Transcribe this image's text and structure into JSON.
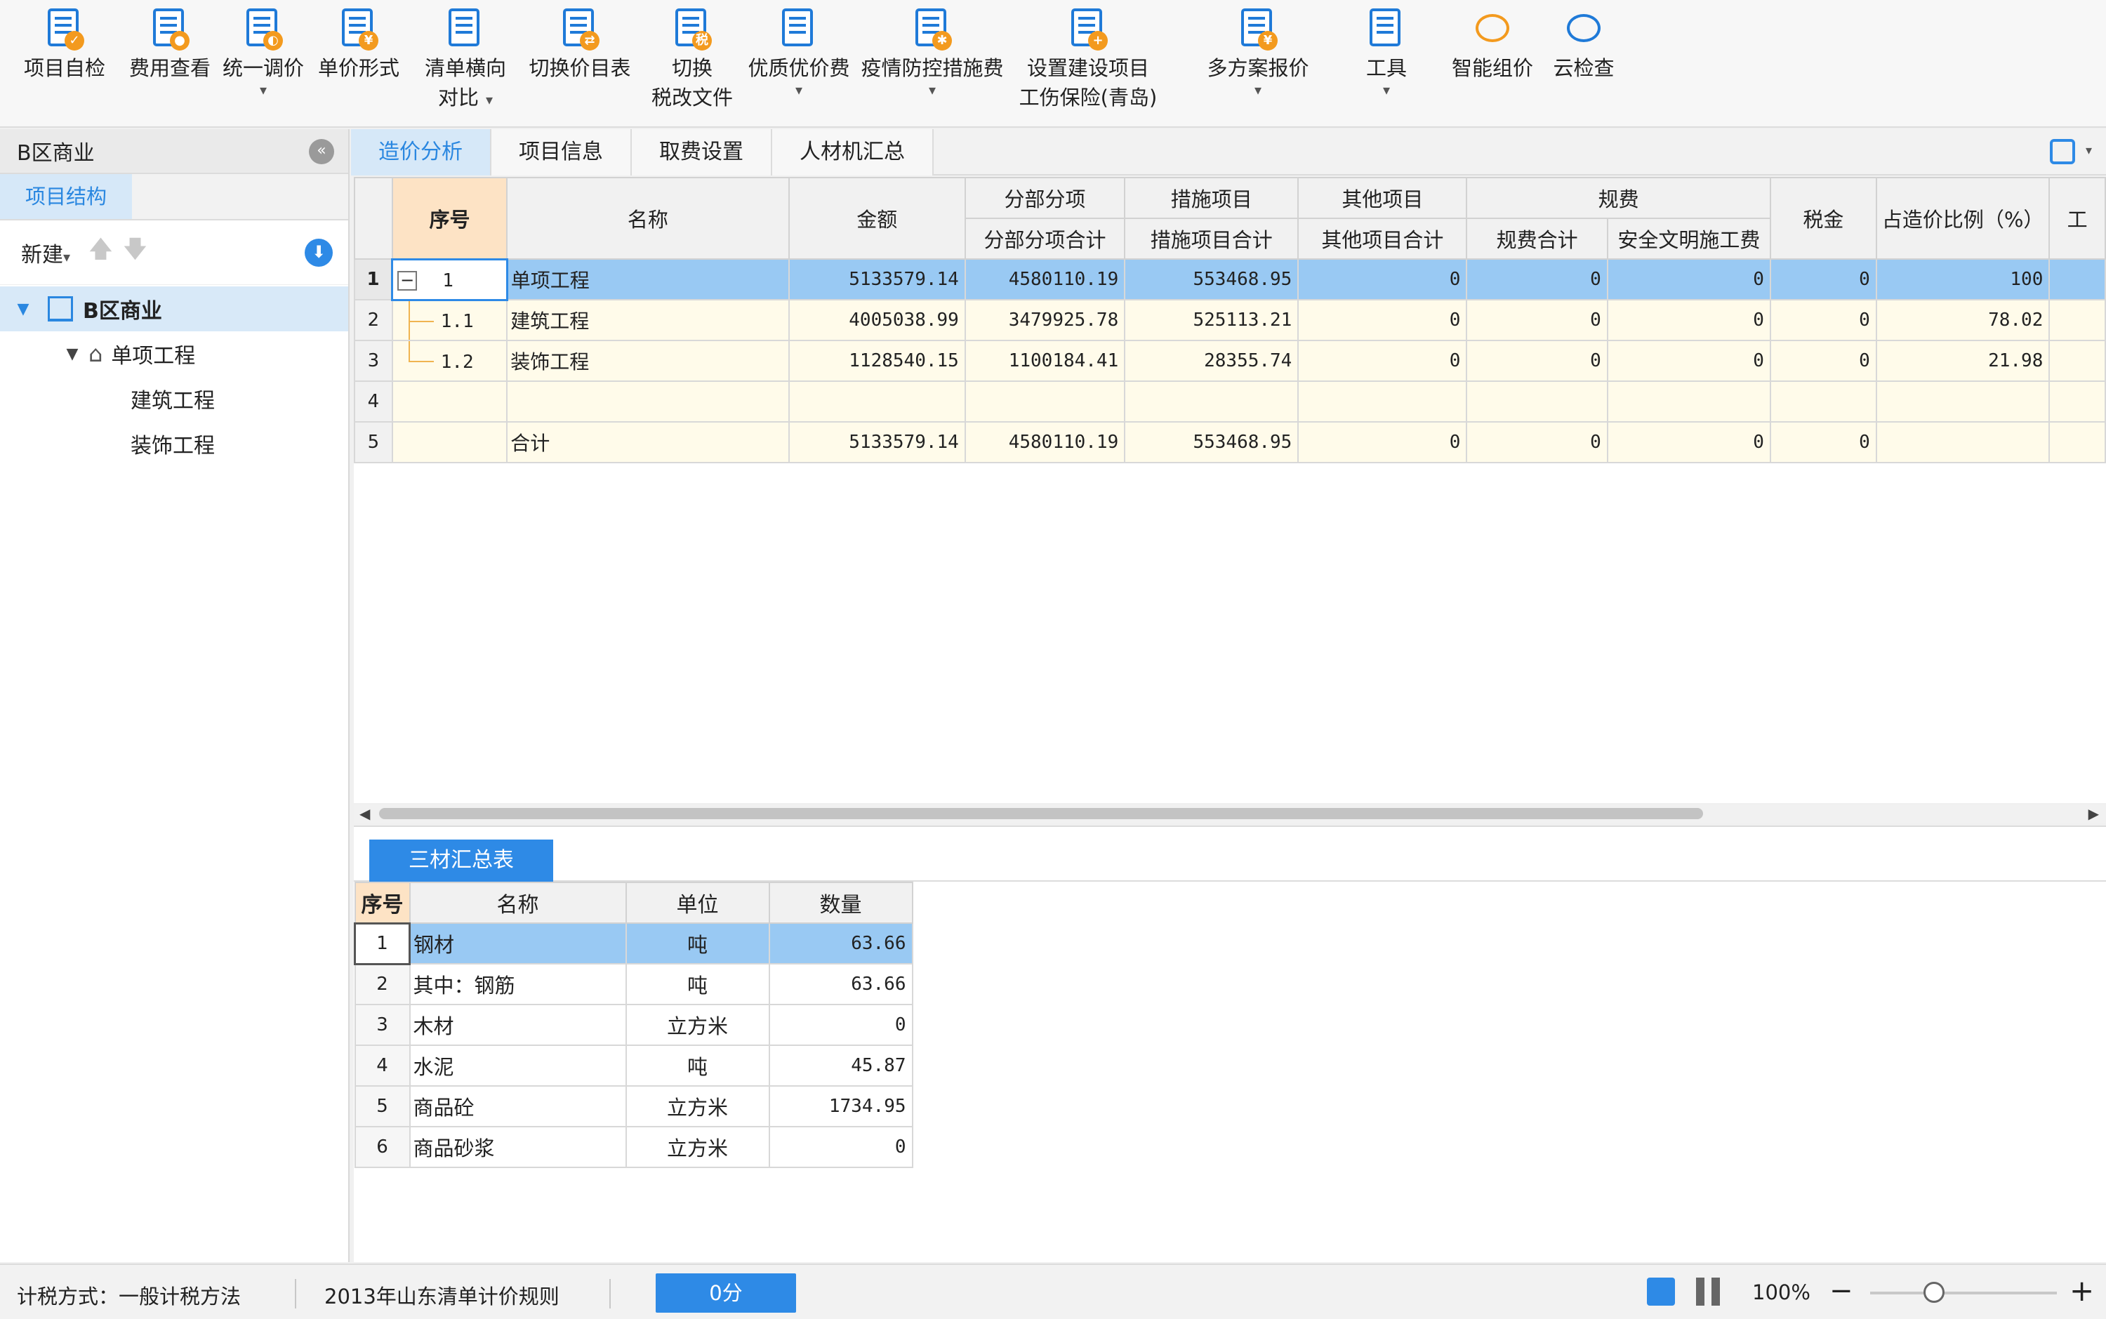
{
  "toolbar": {
    "items": [
      {
        "label": "项目自检",
        "icon": "check-doc-icon"
      },
      {
        "label": "费用查看",
        "icon": "view-cost-icon"
      },
      {
        "label": "统一调价",
        "icon": "adjust-price-icon",
        "dropdown": "▾"
      },
      {
        "label": "单价形式",
        "icon": "unit-price-icon"
      },
      {
        "label": "清单横向",
        "label2": "对比",
        "icon": "compare-icon",
        "dropdown": "▾"
      },
      {
        "label": "切换价目表",
        "icon": "switch-price-table-icon"
      },
      {
        "label": "切换",
        "label2": "税改文件",
        "icon": "tax-file-icon"
      },
      {
        "label": "优质优价费",
        "icon": "quality-price-icon",
        "dropdown": "▾"
      },
      {
        "label": "疫情防控措施费",
        "icon": "epidemic-icon",
        "dropdown": "▾"
      },
      {
        "label": "设置建设项目",
        "label2": "工伤保险(青岛)",
        "icon": "insurance-icon"
      },
      {
        "label": "多方案报价",
        "icon": "multi-plan-icon",
        "dropdown": "▾"
      },
      {
        "label": "工具",
        "icon": "tools-icon",
        "dropdown": "▾"
      },
      {
        "label": "智能组价",
        "icon": "smart-price-icon"
      },
      {
        "label": "云检查",
        "icon": "cloud-check-icon"
      }
    ]
  },
  "left_panel": {
    "title": "B区商业",
    "collapse": "«",
    "tab": "项目结构",
    "new_label": "新建",
    "new_caret": "▾",
    "up": "🡅",
    "down": "🡇",
    "import": "⬇",
    "tree": {
      "root": "B区商业",
      "child": "单项工程",
      "leaves": [
        "建筑工程",
        "装饰工程"
      ]
    }
  },
  "main_tabs": [
    "造价分析",
    "项目信息",
    "取费设置",
    "人材机汇总"
  ],
  "cost_table": {
    "headers": {
      "seq": "序号",
      "name": "名称",
      "amount": "金额",
      "fbfx_group": "分部分项",
      "fbfx_sub": "分部分项合计",
      "csxm_group": "措施项目",
      "csxm_sub": "措施项目合计",
      "qtxm_group": "其他项目",
      "qtxm_sub": "其他项目合计",
      "gf_group": "规费",
      "gf_sub1": "规费合计",
      "gf_sub2": "安全文明施工费",
      "tax": "税金",
      "ratio": "占造价比例（%）",
      "extra": "工"
    },
    "rows": [
      {
        "no": "1",
        "seq": "1",
        "name": "单项工程",
        "amount": "5133579.14",
        "fbfx": "4580110.19",
        "csxm": "553468.95",
        "qtxm": "0",
        "gf": "0",
        "aqwm": "0",
        "tax": "0",
        "ratio": "100"
      },
      {
        "no": "2",
        "seq": "1.1",
        "name": "建筑工程",
        "amount": "4005038.99",
        "fbfx": "3479925.78",
        "csxm": "525113.21",
        "qtxm": "0",
        "gf": "0",
        "aqwm": "0",
        "tax": "0",
        "ratio": "78.02"
      },
      {
        "no": "3",
        "seq": "1.2",
        "name": "装饰工程",
        "amount": "1128540.15",
        "fbfx": "1100184.41",
        "csxm": "28355.74",
        "qtxm": "0",
        "gf": "0",
        "aqwm": "0",
        "tax": "0",
        "ratio": "21.98"
      },
      {
        "no": "4",
        "seq": "",
        "name": "",
        "amount": "",
        "fbfx": "",
        "csxm": "",
        "qtxm": "",
        "gf": "",
        "aqwm": "",
        "tax": "",
        "ratio": ""
      },
      {
        "no": "5",
        "seq": "",
        "name": "合计",
        "amount": "5133579.14",
        "fbfx": "4580110.19",
        "csxm": "553468.95",
        "qtxm": "0",
        "gf": "0",
        "aqwm": "0",
        "tax": "0",
        "ratio": ""
      }
    ]
  },
  "bottom": {
    "tab": "三材汇总表",
    "headers": {
      "seq": "序号",
      "name": "名称",
      "unit": "单位",
      "qty": "数量"
    },
    "rows": [
      {
        "no": "1",
        "name": "钢材",
        "unit": "吨",
        "qty": "63.66"
      },
      {
        "no": "2",
        "name": "其中：钢筋",
        "unit": "吨",
        "qty": "63.66"
      },
      {
        "no": "3",
        "name": "木材",
        "unit": "立方米",
        "qty": "0"
      },
      {
        "no": "4",
        "name": "水泥",
        "unit": "吨",
        "qty": "45.87"
      },
      {
        "no": "5",
        "name": "商品砼",
        "unit": "立方米",
        "qty": "1734.95"
      },
      {
        "no": "6",
        "name": "商品砂浆",
        "unit": "立方米",
        "qty": "0"
      }
    ]
  },
  "statusbar": {
    "tax_method": "计税方式：一般计税方法",
    "rule": "2013年山东清单计价规则",
    "score": "0分",
    "zoom": "100%",
    "zoom_out": "−",
    "zoom_in": "+"
  },
  "colors": {
    "accent": "#2e8ae6",
    "selected_row": "#99c9f3",
    "highlight_header": "#fde3c5",
    "row_bg": "#fffbea"
  }
}
